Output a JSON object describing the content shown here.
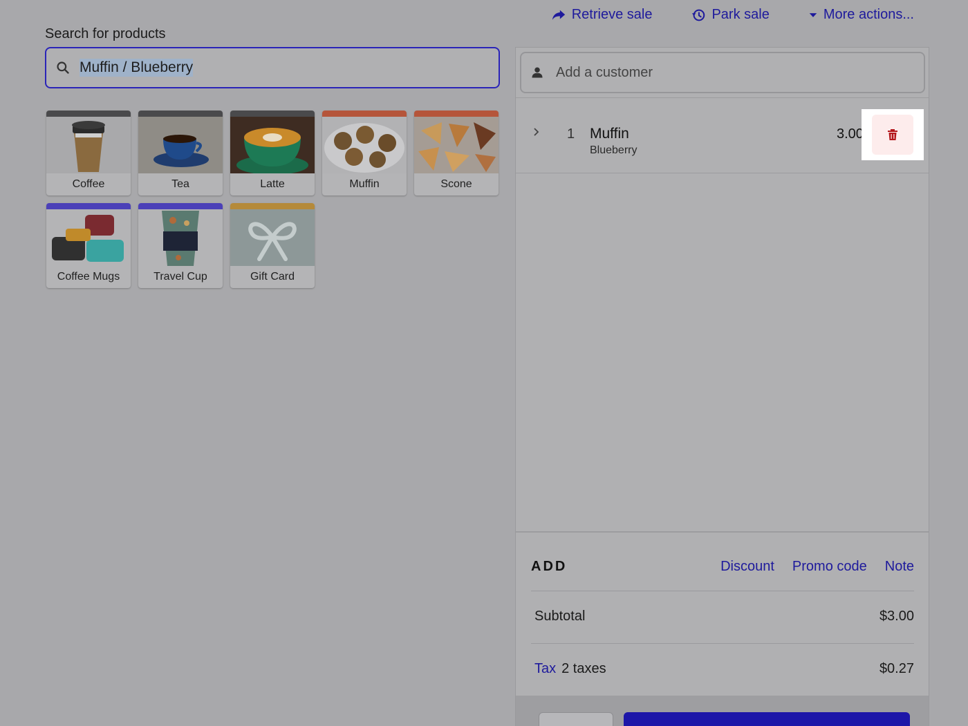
{
  "top_actions": {
    "retrieve_sale": "Retrieve sale",
    "park_sale": "Park sale",
    "more_actions": "More actions..."
  },
  "search": {
    "label": "Search for products",
    "value": "Muffin / Blueberry"
  },
  "products": [
    {
      "label": "Coffee",
      "color": "#4a4a4c"
    },
    {
      "label": "Tea",
      "color": "#4a4a4c"
    },
    {
      "label": "Latte",
      "color": "#4a4a4c"
    },
    {
      "label": "Muffin",
      "color": "#b5553a"
    },
    {
      "label": "Scone",
      "color": "#b5553a"
    },
    {
      "label": "Coffee Mugs",
      "color": "#4b40b8"
    },
    {
      "label": "Travel Cup",
      "color": "#4b40b8"
    },
    {
      "label": "Gift Card",
      "color": "#b58a3a"
    }
  ],
  "cart": {
    "customer_placeholder": "Add a customer",
    "items": [
      {
        "qty": "1",
        "name": "Muffin",
        "variant": "Blueberry",
        "price": "3.00"
      }
    ],
    "add_title": "ADD",
    "add_links": [
      "Discount",
      "Promo code",
      "Note"
    ],
    "subtotal_label": "Subtotal",
    "subtotal_value": "$3.00",
    "tax_label": "Tax",
    "tax_detail": "2 taxes",
    "tax_value": "$0.27"
  },
  "colors": {
    "accent": "#1e1a9c",
    "delete": "#b3161b"
  }
}
